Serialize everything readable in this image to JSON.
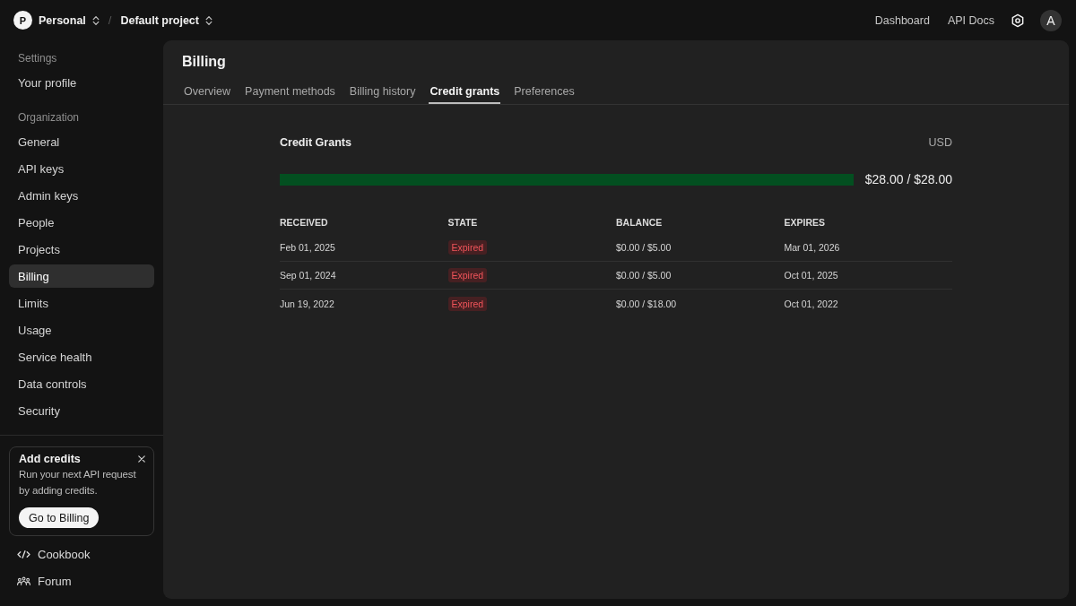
{
  "topbar": {
    "org_avatar": "P",
    "org": "Personal",
    "separator": "/",
    "project": "Default project",
    "links": [
      "Dashboard",
      "API Docs"
    ],
    "user_avatar": "A"
  },
  "sidebar": {
    "sections": [
      {
        "heading": "Settings",
        "items": [
          {
            "label": "Your profile",
            "selected": false
          }
        ]
      },
      {
        "heading": "Organization",
        "items": [
          {
            "label": "General",
            "selected": false
          },
          {
            "label": "API keys",
            "selected": false
          },
          {
            "label": "Admin keys",
            "selected": false
          },
          {
            "label": "People",
            "selected": false
          },
          {
            "label": "Projects",
            "selected": false
          },
          {
            "label": "Billing",
            "selected": true
          },
          {
            "label": "Limits",
            "selected": false
          },
          {
            "label": "Usage",
            "selected": false
          },
          {
            "label": "Service health",
            "selected": false
          },
          {
            "label": "Data controls",
            "selected": false
          },
          {
            "label": "Security",
            "selected": false
          }
        ]
      }
    ],
    "promo": {
      "title": "Add credits",
      "text": "Run your next API request by adding credits.",
      "button": "Go to Billing"
    },
    "footer_links": [
      "Cookbook",
      "Forum"
    ]
  },
  "page": {
    "title": "Billing",
    "tabs": [
      {
        "label": "Overview",
        "selected": false
      },
      {
        "label": "Payment methods",
        "selected": false
      },
      {
        "label": "Billing history",
        "selected": false
      },
      {
        "label": "Credit grants",
        "selected": true
      },
      {
        "label": "Preferences",
        "selected": false
      }
    ],
    "credit_grants": {
      "title": "Credit Grants",
      "currency": "USD",
      "usage": {
        "level": 1,
        "reading": "$28.00 / $28.00"
      },
      "table": {
        "columns": [
          "RECEIVED",
          "STATE",
          "BALANCE",
          "EXPIRES"
        ],
        "rows": [
          {
            "received": "Feb 01, 2025",
            "state": "Expired",
            "balance": "$0.00 / $5.00",
            "expires": "Mar 01, 2026"
          },
          {
            "received": "Sep 01, 2024",
            "state": "Expired",
            "balance": "$0.00 / $5.00",
            "expires": "Oct 01, 2025"
          },
          {
            "received": "Jun 19, 2022",
            "state": "Expired",
            "balance": "$0.00 / $18.00",
            "expires": "Oct 01, 2022"
          }
        ]
      }
    }
  }
}
